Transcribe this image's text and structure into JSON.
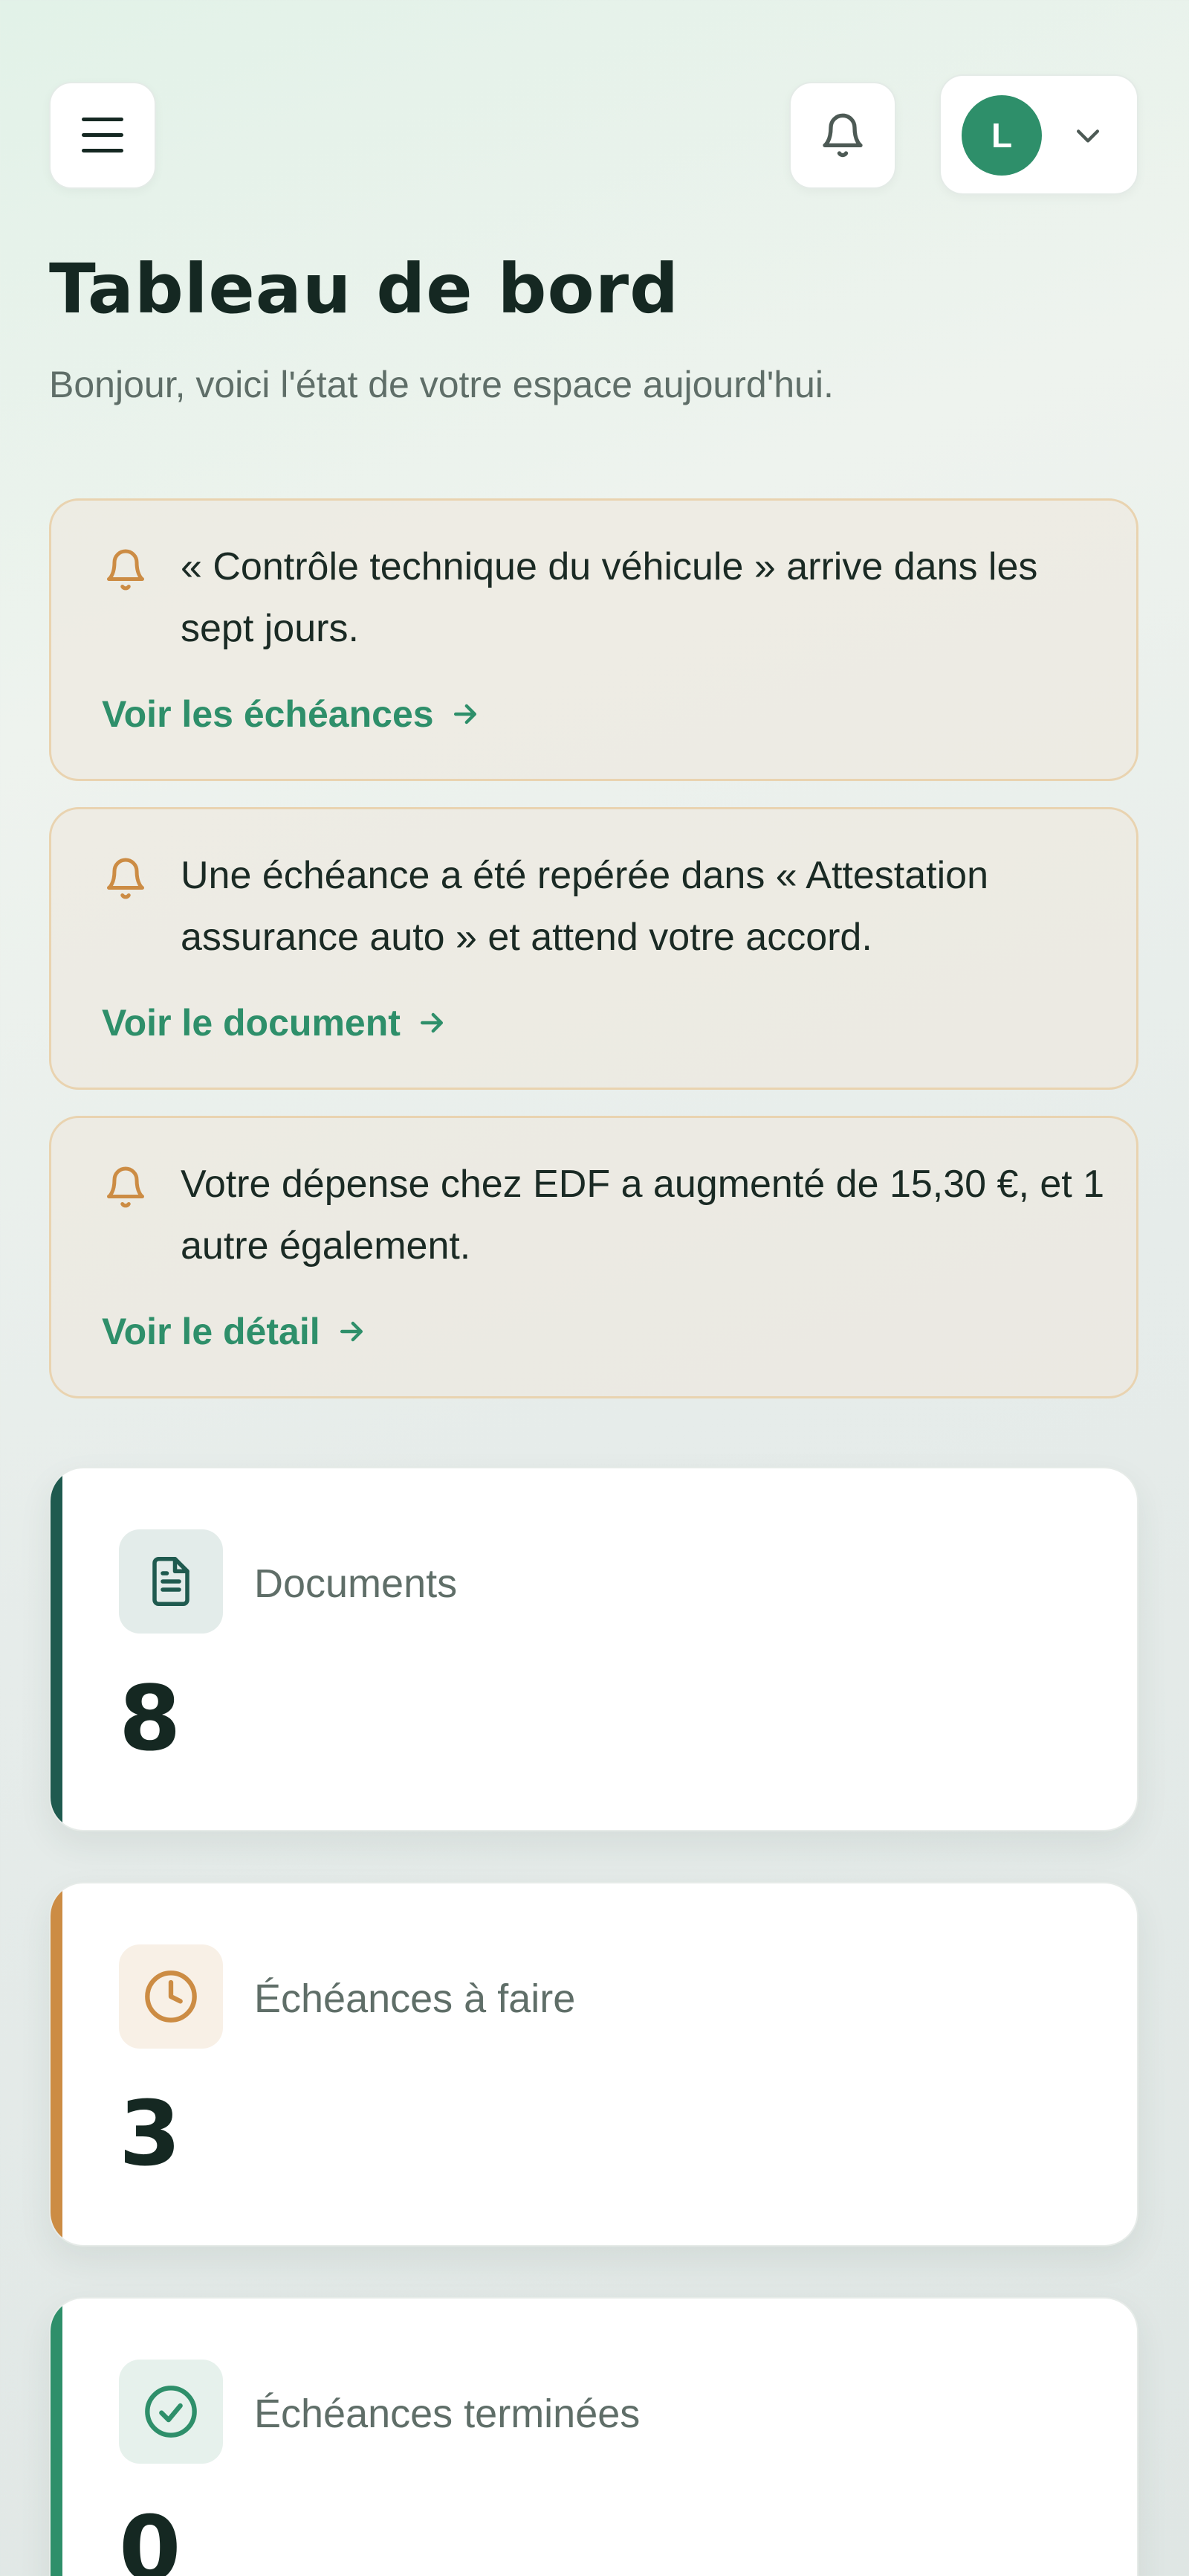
{
  "header": {
    "avatar_initial": "L",
    "icons": {
      "menu": "menu-icon",
      "bell": "bell-icon",
      "chevron": "chevron-down-icon"
    }
  },
  "page": {
    "title": "Tableau de bord",
    "subtitle": "Bonjour, voici l'état de votre espace aujourd'hui."
  },
  "alerts": [
    {
      "message": "« Contrôle technique du véhicule » arrive dans les sept jours.",
      "link": "Voir les échéances"
    },
    {
      "message": "Une échéance a été repérée dans « Attestation assurance auto » et attend votre accord.",
      "link": "Voir le document"
    },
    {
      "message": "Votre dépense chez EDF a augmenté de 15,30 €, et 1 autre également.",
      "link": "Voir le détail"
    }
  ],
  "stats": [
    {
      "label": "Documents",
      "value": "8",
      "icon": "document-icon",
      "accent": "#1f5a4f"
    },
    {
      "label": "Échéances à faire",
      "value": "3",
      "icon": "clock-icon",
      "accent": "#cc8c44"
    },
    {
      "label": "Échéances terminées",
      "value": "0",
      "icon": "check-circle-icon",
      "accent": "#2e8f6a"
    }
  ],
  "colors": {
    "brand": "#2e8f6a",
    "warning": "#cc8c44",
    "dark_teal": "#1f5a4f",
    "text": "#152822",
    "muted": "#5f6e68"
  }
}
